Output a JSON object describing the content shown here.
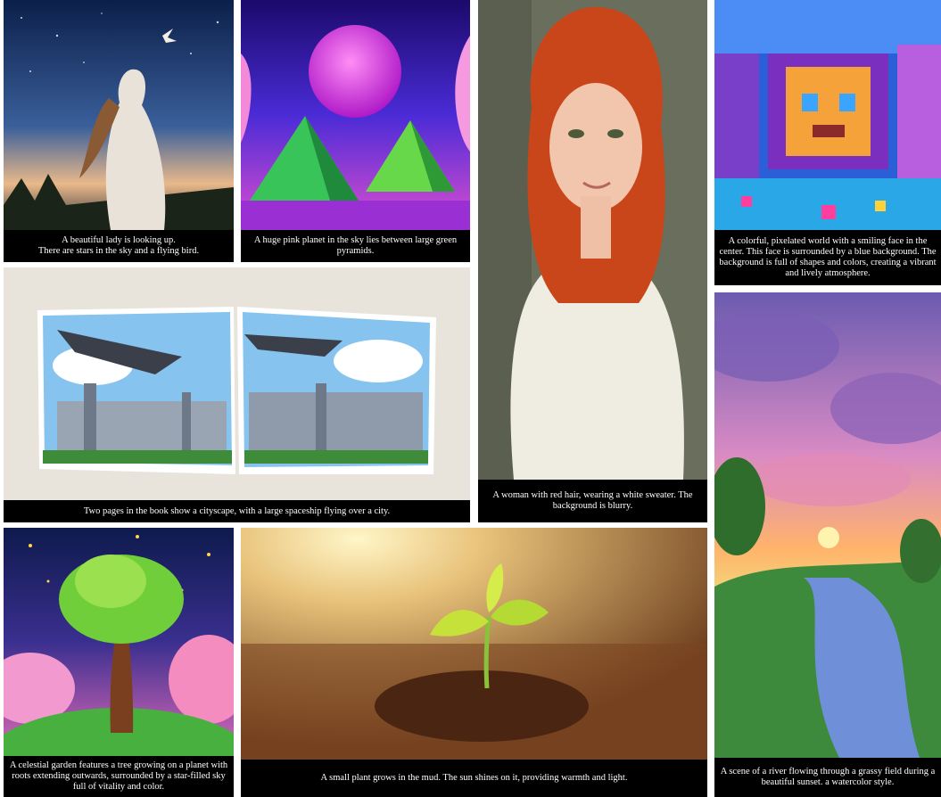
{
  "tiles": [
    {
      "id": "lady-stars",
      "caption": "A beautiful lady is looking up.\nThere are stars in the sky and a flying bird."
    },
    {
      "id": "pink-planet",
      "caption": "A huge pink planet in the sky lies between large green pyramids."
    },
    {
      "id": "red-hair-woman",
      "caption": "A woman with red hair, wearing a white sweater. The background is blurry."
    },
    {
      "id": "pixel-world",
      "caption": "A colorful, pixelated world with a smiling face in the center. This face is surrounded by a blue background. The background is full of shapes and colors, creating a vibrant and lively atmosphere."
    },
    {
      "id": "book-cityscape",
      "caption": "Two pages in the book show a cityscape, with a large spaceship flying over a city."
    },
    {
      "id": "river-sunset",
      "caption": "A scene of a river flowing through a grassy field during a beautiful sunset. a watercolor style."
    },
    {
      "id": "celestial-tree",
      "caption": "A celestial garden features a tree growing on a planet with roots extending outwards, surrounded by a star-filled sky full of vitality and color."
    },
    {
      "id": "small-plant",
      "caption": "A small plant grows in the mud. The sun shines on it, providing warmth and light."
    }
  ]
}
